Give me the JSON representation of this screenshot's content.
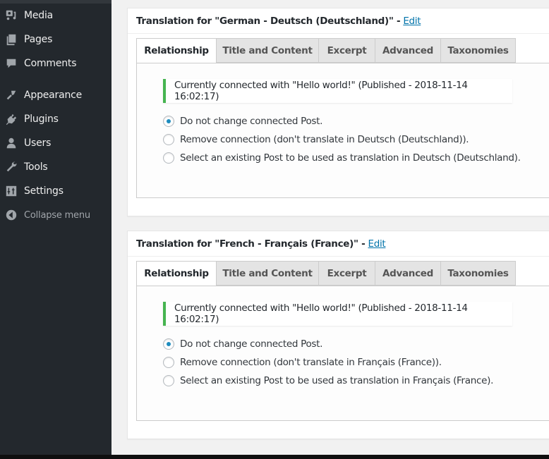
{
  "sidebar": {
    "items": [
      {
        "label": "Media",
        "icon": "media-icon"
      },
      {
        "label": "Pages",
        "icon": "pages-icon"
      },
      {
        "label": "Comments",
        "icon": "comments-icon"
      },
      {
        "label": "Appearance",
        "icon": "appearance-icon"
      },
      {
        "label": "Plugins",
        "icon": "plugins-icon"
      },
      {
        "label": "Users",
        "icon": "users-icon"
      },
      {
        "label": "Tools",
        "icon": "tools-icon"
      },
      {
        "label": "Settings",
        "icon": "settings-icon"
      }
    ],
    "collapse_label": "Collapse menu"
  },
  "colors": {
    "sidebar_bg": "#23282d",
    "link": "#0073aa",
    "notice_accent": "#46b450",
    "radio_checked": "#1e8cbe"
  },
  "panels": [
    {
      "title": "Translation for \"German - Deutsch (Deutschland)\" -",
      "edit_label": "Edit",
      "tabs": [
        "Relationship",
        "Title and Content",
        "Excerpt",
        "Advanced",
        "Taxonomies"
      ],
      "active_tab": "Relationship",
      "notice": "Currently connected with \"Hello world!\" (Published - 2018-11-14 16:02:17)",
      "options": [
        {
          "label": "Do not change connected Post.",
          "checked": true
        },
        {
          "label": "Remove connection (don't translate in Deutsch (Deutschland)).",
          "checked": false
        },
        {
          "label": "Select an existing Post to be used as translation in Deutsch (Deutschland).",
          "checked": false
        }
      ]
    },
    {
      "title": "Translation for \"French - Français (France)\" -",
      "edit_label": "Edit",
      "tabs": [
        "Relationship",
        "Title and Content",
        "Excerpt",
        "Advanced",
        "Taxonomies"
      ],
      "active_tab": "Relationship",
      "notice": "Currently connected with \"Hello world!\" (Published - 2018-11-14 16:02:17)",
      "options": [
        {
          "label": "Do not change connected Post.",
          "checked": true
        },
        {
          "label": "Remove connection (don't translate in Français (France)).",
          "checked": false
        },
        {
          "label": "Select an existing Post to be used as translation in Français (France).",
          "checked": false
        }
      ]
    }
  ]
}
